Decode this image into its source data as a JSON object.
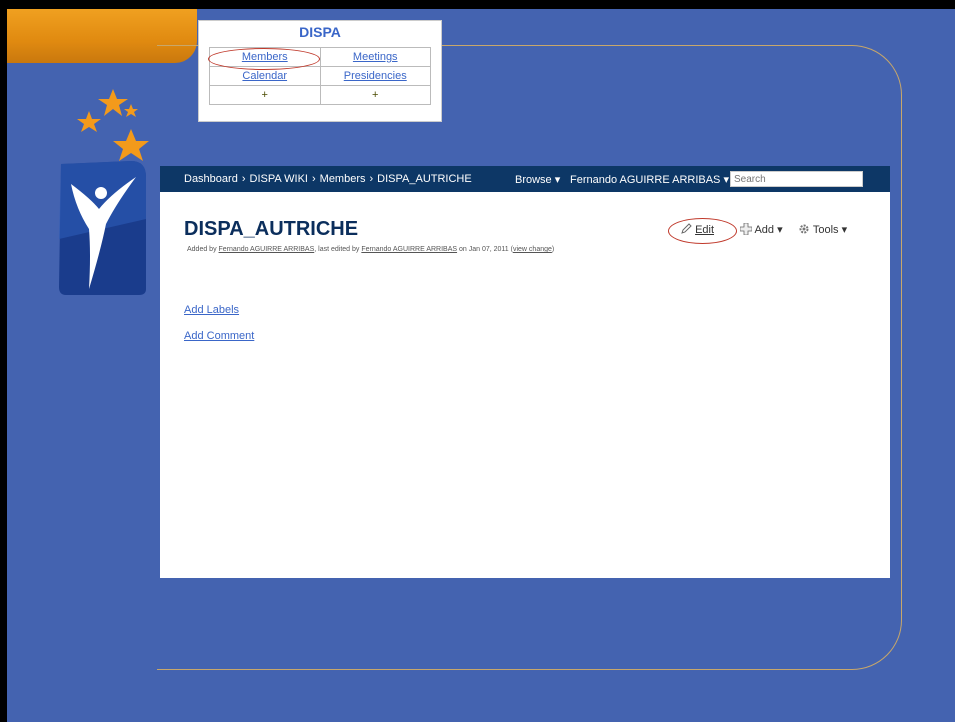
{
  "dispa_nav": {
    "title": "DISPA",
    "links": {
      "members": "Members",
      "meetings": "Meetings",
      "calendar": "Calendar",
      "presidencies": "Presidencies",
      "add_left": "+",
      "add_right": "+"
    }
  },
  "topbar": {
    "breadcrumb": [
      "Dashboard",
      "DISPA WIKI",
      "Members",
      "DISPA_AUTRICHE"
    ],
    "separator": "›",
    "browse": "Browse ▾",
    "user": "Fernando AGUIRRE ARRIBAS ▾",
    "search_placeholder": "Search"
  },
  "page": {
    "title": "DISPA_AUTRICHE",
    "meta": {
      "added_by_prefix": "Added by ",
      "author": "Fernando AGUIRRE ARRIBAS",
      "edited_prefix": ", last edited by ",
      "editor": "Fernando AGUIRRE ARRIBAS",
      "date_text": " on Jan 07, 2011  (",
      "view_change": "view change",
      "close": ")"
    },
    "actions": {
      "edit": "Edit",
      "add": "Add ▾",
      "tools": "Tools ▾"
    },
    "add_labels": "Add Labels",
    "add_comment": "Add Comment"
  },
  "colors": {
    "background": "#4463b0",
    "topbar": "#0d3766",
    "accent_orange": "#e08a10",
    "annotation_red": "#c0392b",
    "link_blue": "#3a66c8"
  }
}
